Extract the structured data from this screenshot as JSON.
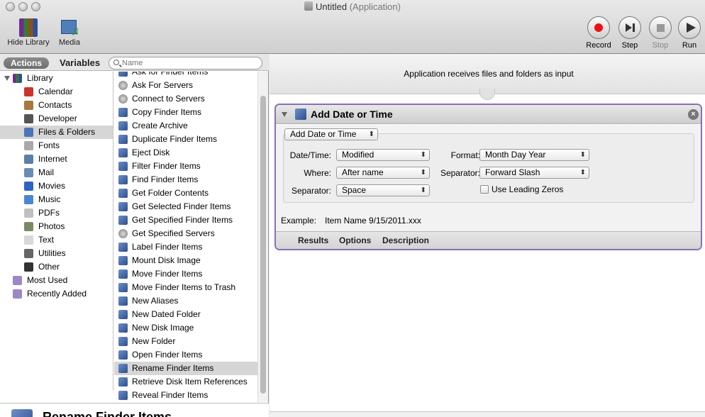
{
  "window": {
    "title": "Untitled",
    "subtitle": "(Application)"
  },
  "toolbar": {
    "hide_library_label": "Hide Library",
    "media_label": "Media",
    "record_label": "Record",
    "step_label": "Step",
    "stop_label": "Stop",
    "run_label": "Run"
  },
  "library_header": {
    "actions_tab": "Actions",
    "variables_tab": "Variables",
    "search_placeholder": "Name"
  },
  "library": {
    "root_label": "Library",
    "items": [
      {
        "label": "Calendar",
        "icon": "calendar-icon",
        "color": "#c9352b"
      },
      {
        "label": "Contacts",
        "icon": "contacts-icon",
        "color": "#a8783e"
      },
      {
        "label": "Developer",
        "icon": "developer-icon",
        "color": "#555555"
      },
      {
        "label": "Files & Folders",
        "icon": "finder-icon",
        "color": "#4d74b6",
        "selected": true
      },
      {
        "label": "Fonts",
        "icon": "fonts-icon",
        "color": "#a9a9a9"
      },
      {
        "label": "Internet",
        "icon": "internet-icon",
        "color": "#5b7fa6"
      },
      {
        "label": "Mail",
        "icon": "mail-icon",
        "color": "#6b8cb5"
      },
      {
        "label": "Movies",
        "icon": "movies-icon",
        "color": "#2f64c0"
      },
      {
        "label": "Music",
        "icon": "music-icon",
        "color": "#4a87d0"
      },
      {
        "label": "PDFs",
        "icon": "pdf-icon",
        "color": "#c0c0c0"
      },
      {
        "label": "Photos",
        "icon": "photos-icon",
        "color": "#7c8a62"
      },
      {
        "label": "Text",
        "icon": "text-icon",
        "color": "#d8d8d8"
      },
      {
        "label": "Utilities",
        "icon": "utilities-icon",
        "color": "#666666"
      },
      {
        "label": "Other",
        "icon": "other-icon",
        "color": "#333333"
      }
    ],
    "extra": [
      {
        "label": "Most Used",
        "icon": "smart-folder-icon",
        "color": "#9d87c4"
      },
      {
        "label": "Recently Added",
        "icon": "smart-folder-icon",
        "color": "#9d87c4"
      }
    ]
  },
  "actions": [
    {
      "label": "Ask for Finder Items",
      "icon": "finder-icon"
    },
    {
      "label": "Ask For Servers",
      "icon": "server-icon"
    },
    {
      "label": "Connect to Servers",
      "icon": "server-icon"
    },
    {
      "label": "Copy Finder Items",
      "icon": "finder-icon"
    },
    {
      "label": "Create Archive",
      "icon": "finder-icon"
    },
    {
      "label": "Duplicate Finder Items",
      "icon": "finder-icon"
    },
    {
      "label": "Eject Disk",
      "icon": "finder-icon"
    },
    {
      "label": "Filter Finder Items",
      "icon": "finder-icon"
    },
    {
      "label": "Find Finder Items",
      "icon": "finder-icon"
    },
    {
      "label": "Get Folder Contents",
      "icon": "finder-icon"
    },
    {
      "label": "Get Selected Finder Items",
      "icon": "finder-icon"
    },
    {
      "label": "Get Specified Finder Items",
      "icon": "finder-icon"
    },
    {
      "label": "Get Specified Servers",
      "icon": "server-icon"
    },
    {
      "label": "Label Finder Items",
      "icon": "finder-icon"
    },
    {
      "label": "Mount Disk Image",
      "icon": "finder-icon"
    },
    {
      "label": "Move Finder Items",
      "icon": "finder-icon"
    },
    {
      "label": "Move Finder Items to Trash",
      "icon": "finder-icon"
    },
    {
      "label": "New Aliases",
      "icon": "finder-icon"
    },
    {
      "label": "New Dated Folder",
      "icon": "finder-icon"
    },
    {
      "label": "New Disk Image",
      "icon": "finder-icon"
    },
    {
      "label": "New Folder",
      "icon": "finder-icon"
    },
    {
      "label": "Open Finder Items",
      "icon": "finder-icon"
    },
    {
      "label": "Rename Finder Items",
      "icon": "finder-icon",
      "selected": true
    },
    {
      "label": "Retrieve Disk Item References",
      "icon": "finder-icon"
    },
    {
      "label": "Reveal Finder Items",
      "icon": "finder-icon"
    }
  ],
  "description": {
    "title": "Rename Finder Items"
  },
  "workflow": {
    "input_text": "Application receives files and folders as input",
    "action_title": "Add Date or Time",
    "mode_popup": "Add Date or Time",
    "fields": {
      "datetime_label": "Date/Time:",
      "datetime_value": "Modified",
      "where_label": "Where:",
      "where_value": "After name",
      "separator_label": "Separator:",
      "separator_value": "Space",
      "format_label": "Format:",
      "format_value": "Month Day Year",
      "separator2_label": "Separator:",
      "separator2_value": "Forward Slash",
      "leading_zeros_label": "Use Leading Zeros"
    },
    "example_label": "Example:",
    "example_value": "Item Name 9/15/2011.xxx",
    "tabs": {
      "results": "Results",
      "options": "Options",
      "description": "Description"
    }
  }
}
